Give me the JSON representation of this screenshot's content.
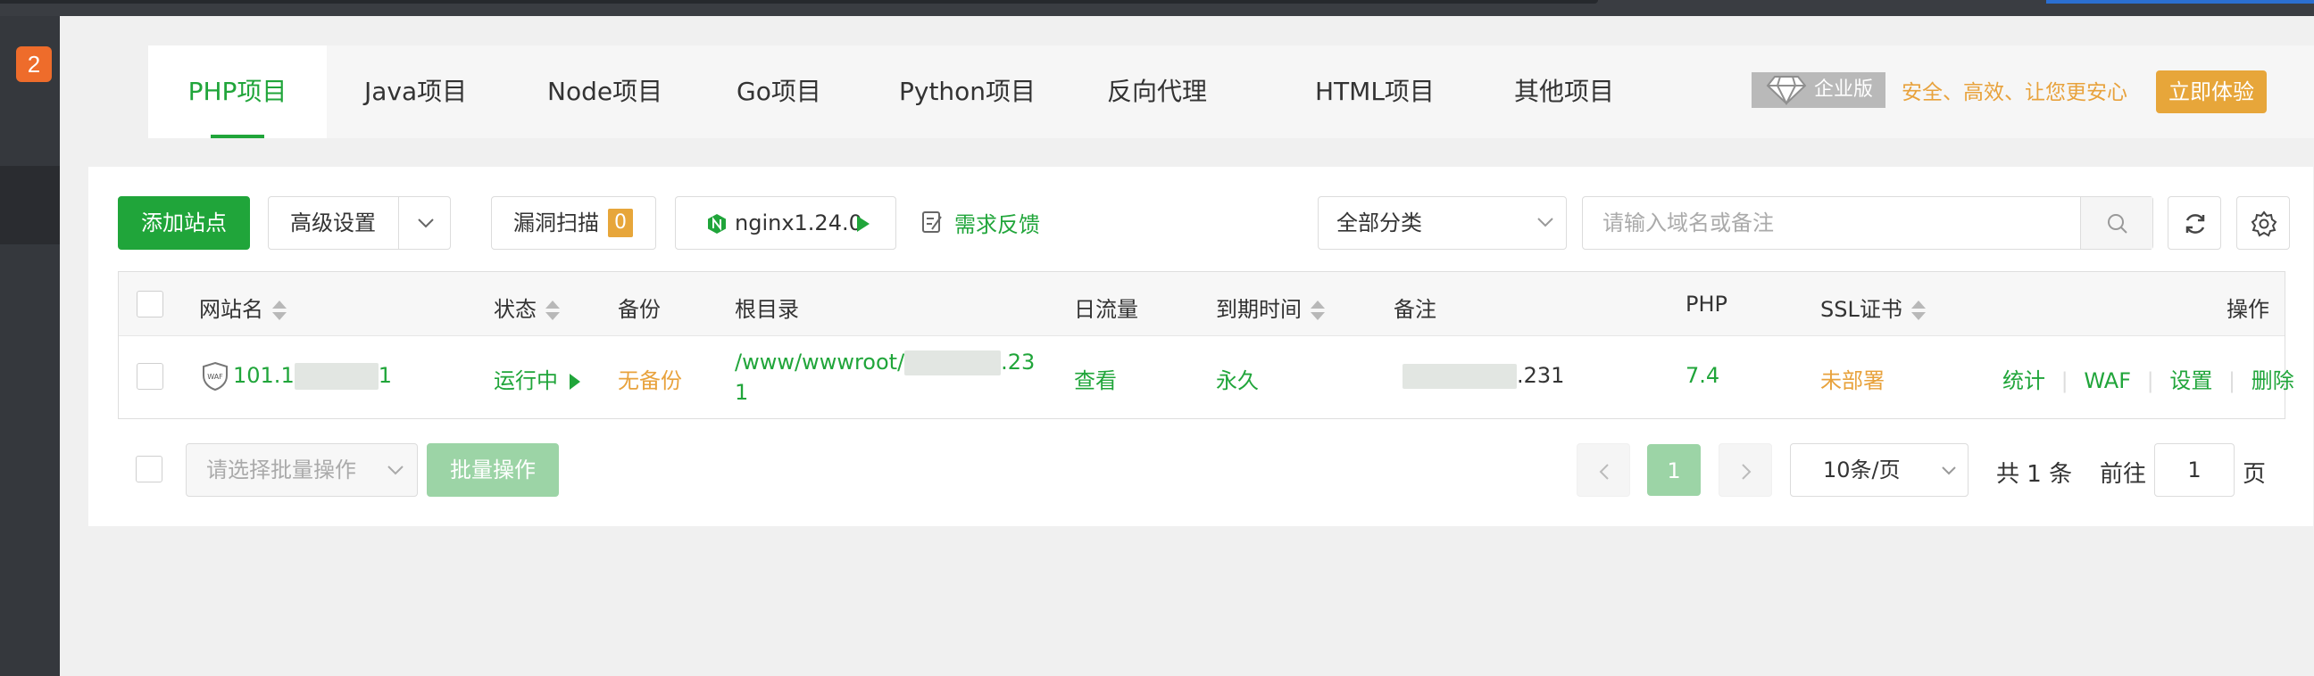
{
  "sidebar": {
    "badge": "2"
  },
  "tabs": [
    {
      "label": "PHP项目",
      "active": true
    },
    {
      "label": "Java项目"
    },
    {
      "label": "Node项目"
    },
    {
      "label": "Go项目"
    },
    {
      "label": "Python项目"
    },
    {
      "label": "反向代理"
    },
    {
      "label": "HTML项目"
    },
    {
      "label": "其他项目"
    }
  ],
  "enterprise": {
    "badge": "企业版",
    "slogan": "安全、高效、让您更安心",
    "button": "立即体验"
  },
  "toolbar": {
    "add_site": "添加站点",
    "advanced": "高级设置",
    "vuln_scan": "漏洞扫描",
    "vuln_count": "0",
    "nginx": "nginx1.24.0",
    "feedback": "需求反馈",
    "category": "全部分类",
    "search_placeholder": "请输入域名或备注"
  },
  "table": {
    "headers": {
      "name": "网站名",
      "status": "状态",
      "backup": "备份",
      "root": "根目录",
      "traffic": "日流量",
      "expire": "到期时间",
      "remark": "备注",
      "php": "PHP",
      "ssl": "SSL证书",
      "actions": "操作"
    },
    "rows": [
      {
        "waf": "WAF",
        "name_start": "101.1",
        "name_end": "1",
        "status": "运行中",
        "backup": "无备份",
        "root_line1": "/www/wwwroot/",
        "root_line1_end": ".23",
        "root_line2": "1",
        "traffic": "查看",
        "expire": "永久",
        "remark_end": ".231",
        "php": "7.4",
        "ssl": "未部署",
        "actions": [
          "统计",
          "WAF",
          "设置",
          "删除"
        ]
      }
    ]
  },
  "footer": {
    "batch_placeholder": "请选择批量操作",
    "batch_button": "批量操作",
    "current_page": "1",
    "page_size": "10条/页",
    "total": "共 1 条",
    "goto_label": "前往",
    "goto_value": "1",
    "page_suffix": "页"
  },
  "colors": {
    "accent": "#20a53a",
    "warning": "#e8a23c",
    "badge": "#ee6c2b"
  }
}
